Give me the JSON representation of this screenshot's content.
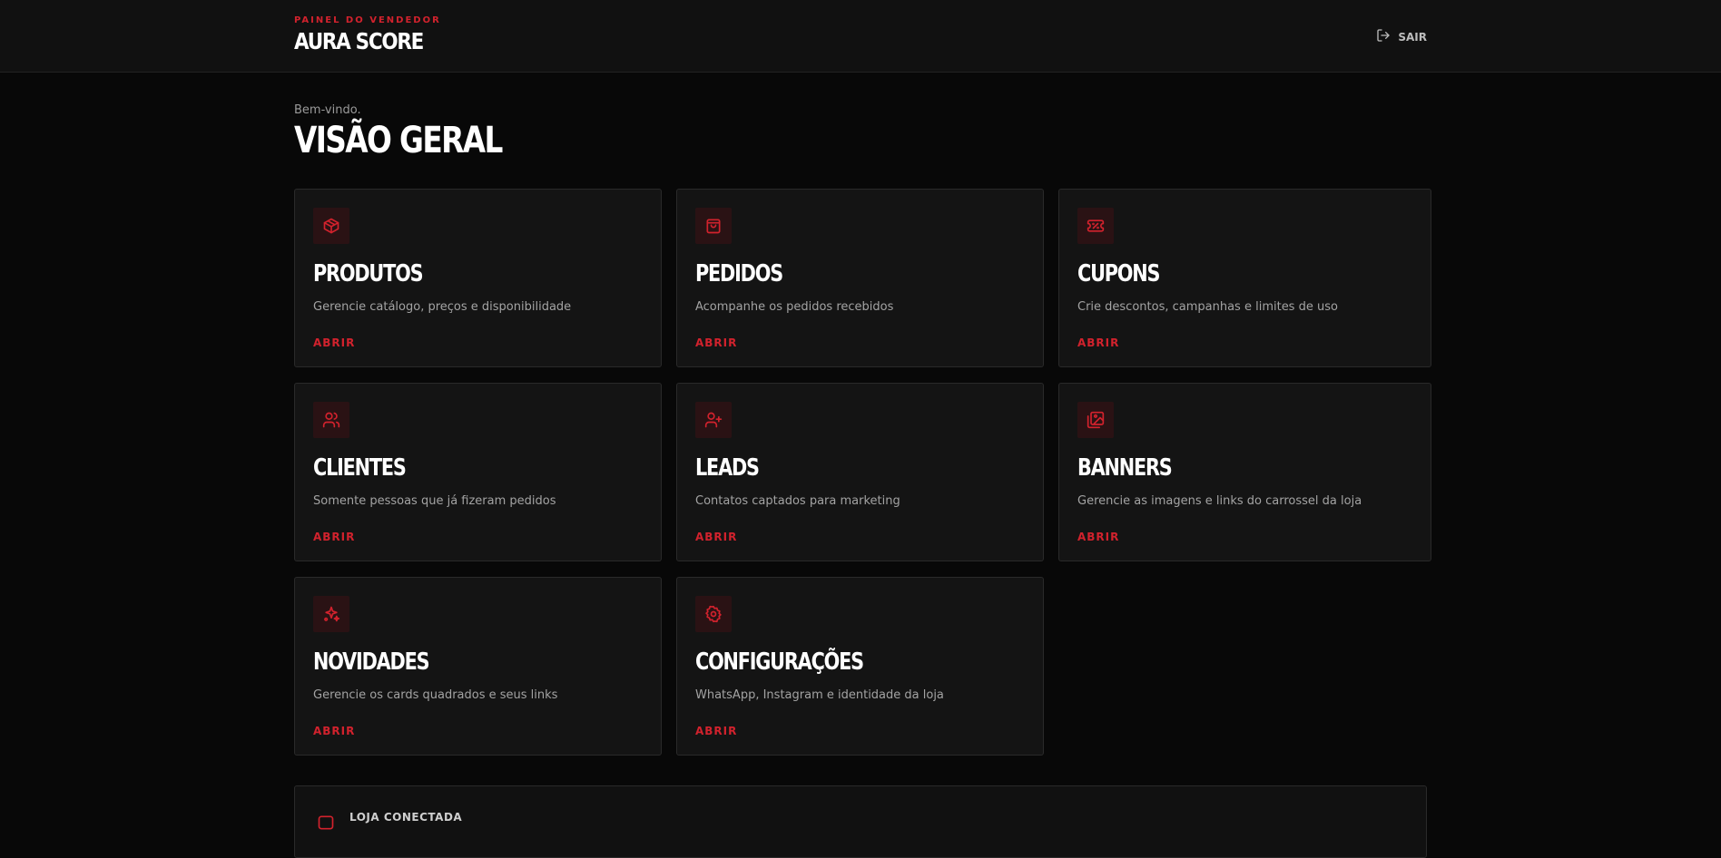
{
  "header": {
    "kicker": "PAINEL DO VENDEDOR",
    "title": "AURA SCORE",
    "logout_label": "SAIR"
  },
  "main": {
    "welcome": "Bem-vindo.",
    "title": "VISÃO GERAL",
    "cards": [
      {
        "title": "PRODUTOS",
        "description": "Gerencie catálogo, preços e disponibilidade",
        "link": "ABRIR",
        "icon": "package-icon"
      },
      {
        "title": "PEDIDOS",
        "description": "Acompanhe os pedidos recebidos",
        "link": "ABRIR",
        "icon": "shopping-bag-icon"
      },
      {
        "title": "CUPONS",
        "description": "Crie descontos, campanhas e limites de uso",
        "link": "ABRIR",
        "icon": "ticket-percent-icon"
      },
      {
        "title": "CLIENTES",
        "description": "Somente pessoas que já fizeram pedidos",
        "link": "ABRIR",
        "icon": "users-icon"
      },
      {
        "title": "LEADS",
        "description": "Contatos captados para marketing",
        "link": "ABRIR",
        "icon": "user-plus-icon"
      },
      {
        "title": "BANNERS",
        "description": "Gerencie as imagens e links do carrossel da loja",
        "link": "ABRIR",
        "icon": "images-icon"
      },
      {
        "title": "NOVIDADES",
        "description": "Gerencie os cards quadrados e seus links",
        "link": "ABRIR",
        "icon": "sparkles-icon"
      },
      {
        "title": "CONFIGURAÇÕES",
        "description": "WhatsApp, Instagram e identidade da loja",
        "link": "ABRIR",
        "icon": "gear-icon"
      }
    ],
    "connected_label": "LOJA CONECTADA"
  },
  "colors": {
    "accent": "#d2222d",
    "background": "#080808",
    "card": "#141414"
  }
}
